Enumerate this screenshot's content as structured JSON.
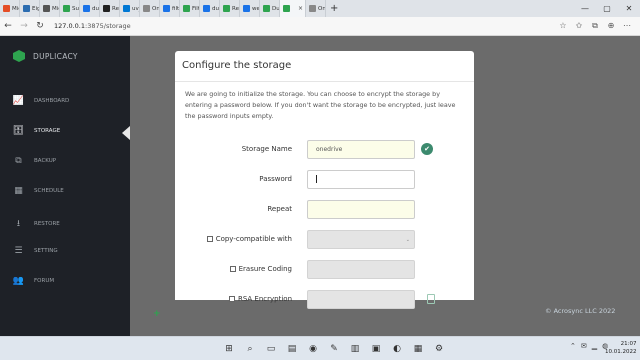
{
  "browser": {
    "tabs": [
      {
        "label": "Micr",
        "color": "#e44d26"
      },
      {
        "label": "Eige",
        "color": "#2b6cb0"
      },
      {
        "label": "Micr",
        "color": "#555555"
      },
      {
        "label": "Supe",
        "color": "#2ea44f"
      },
      {
        "label": "dupl",
        "color": "#1a73e8"
      },
      {
        "label": "Rele",
        "color": "#222222"
      },
      {
        "label": "uv_b",
        "color": "#0078d4"
      },
      {
        "label": "One",
        "color": "#888888"
      },
      {
        "label": "filter",
        "color": "#1a73e8"
      },
      {
        "label": "Filter",
        "color": "#2ea44f"
      },
      {
        "label": "dupl",
        "color": "#1a73e8"
      },
      {
        "label": "Resto",
        "color": "#2ea44f"
      },
      {
        "label": "web",
        "color": "#1a73e8"
      },
      {
        "label": "Dupl",
        "color": "#2ea44f"
      },
      {
        "label": "",
        "color": "#2ea44f",
        "active": true
      },
      {
        "label": "One",
        "color": "#888888"
      }
    ],
    "new_tab": "+",
    "window_controls": [
      "—",
      "▢",
      "✕"
    ],
    "back": "←",
    "forward": "→",
    "reload": "↻",
    "address_host": "127.0.0.1",
    "address_path": ":3875/storage",
    "tool_icons": [
      "☆",
      "✩",
      "⧉",
      "⊕",
      "⋯"
    ]
  },
  "sidebar": {
    "brand": "DUPLICACY",
    "items": [
      {
        "label": "DASHBOARD",
        "icon": "📈"
      },
      {
        "label": "STORAGE",
        "icon": "🗄",
        "active": true
      },
      {
        "label": "BACKUP",
        "icon": "⧉"
      },
      {
        "label": "SCHEDULE",
        "icon": "▦"
      },
      {
        "label": "RESTORE",
        "icon": "⭳"
      },
      {
        "label": "SETTING",
        "icon": "☰"
      },
      {
        "label": "FORUM",
        "icon": "👥"
      }
    ]
  },
  "main": {
    "add_button": "+",
    "copyright": "© Acrosync LLC 2022"
  },
  "dialog": {
    "title": "Configure the storage",
    "description": "We are going to initialize the storage. You can choose to encrypt the storage by entering a password below. If you don't want the storage to be encrypted, just leave the password inputs empty.",
    "storage_name_label": "Storage Name",
    "storage_name_value": "onedrive",
    "password_label": "Password",
    "password_value": "",
    "repeat_label": "Repeat",
    "repeat_value": "",
    "copy_compatible_label": "Copy-compatible with",
    "copy_compatible_value": "",
    "erasure_coding_label": "Erasure Coding",
    "erasure_coding_value": "",
    "rsa_label": "RSA Encryption",
    "rsa_value": ""
  },
  "taskbar": {
    "icons": [
      "⊞",
      "⌕",
      "▭",
      "▤",
      "◉",
      "✎",
      "▥",
      "▣",
      "◐",
      "▦",
      "⚙"
    ],
    "tray": [
      "⌃",
      "✉",
      "▁",
      "◍"
    ],
    "time": "21:07",
    "date": "10.01.2022"
  },
  "colors": {
    "sidebar_bg": "#1e2127",
    "brand_green": "#2ea44f",
    "check_green": "#3c8a6e",
    "field_yellow": "#fcfde9"
  }
}
